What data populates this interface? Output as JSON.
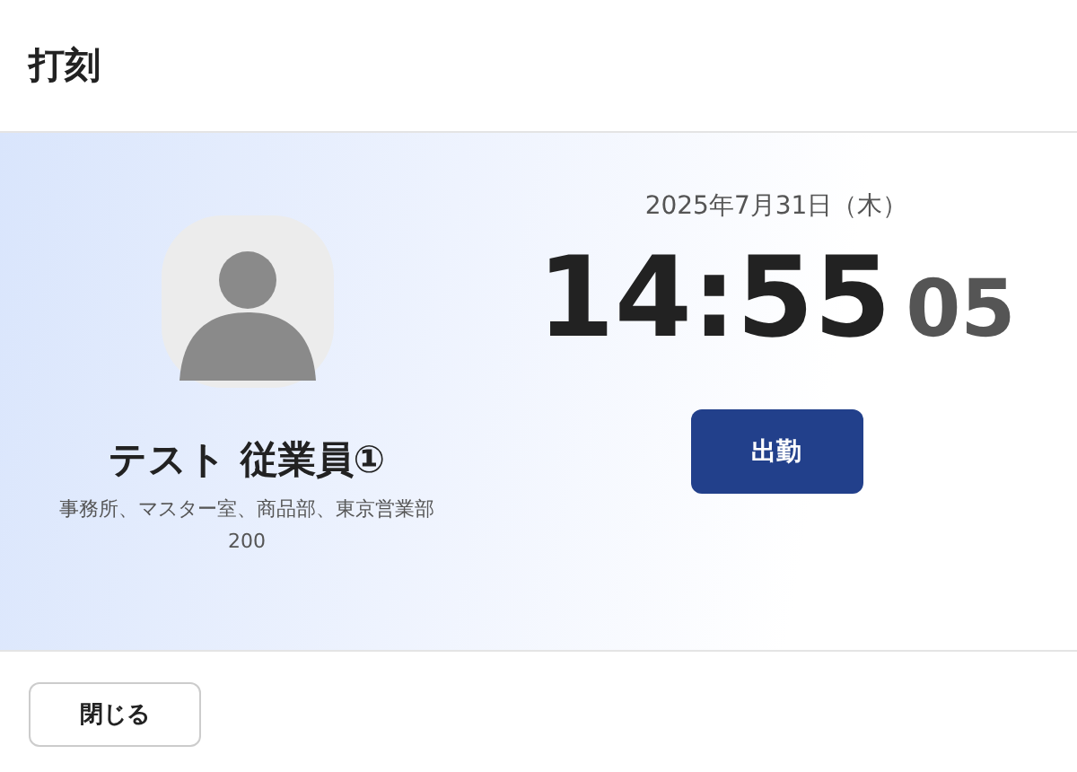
{
  "header": {
    "title": "打刻"
  },
  "employee": {
    "name": "テスト 従業員①",
    "departments": "事務所、マスター室、商品部、東京営業部",
    "code": "200"
  },
  "clock": {
    "date": "2025年7月31日（木）",
    "time": "14:55",
    "seconds": "05"
  },
  "punch_button": "出勤",
  "footer": {
    "close_button": "閉じる"
  }
}
